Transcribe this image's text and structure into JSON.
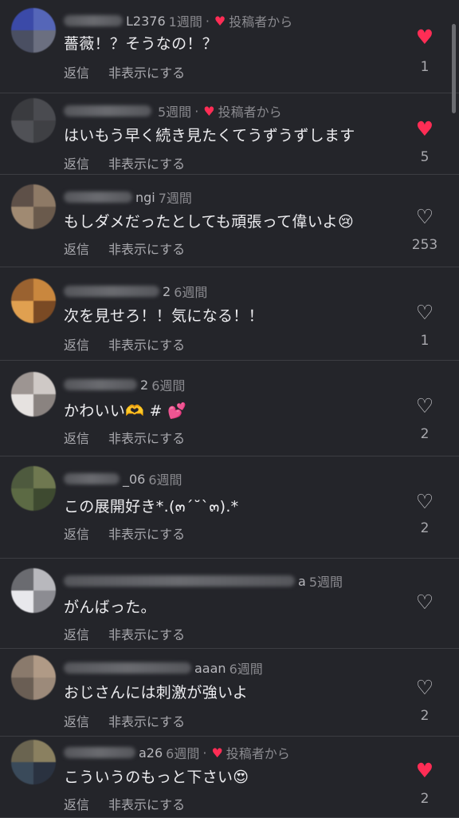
{
  "comments": [
    {
      "name_tail": "L2376",
      "time": "1週間",
      "liked_by_author": true,
      "author_label": "投稿者から",
      "text": "薔薇！？そうなの！？",
      "reply": "返信",
      "hide": "非表示にする",
      "liked": true,
      "likes": "1"
    },
    {
      "name_tail": "",
      "time": "5週間",
      "liked_by_author": true,
      "author_label": "投稿者から",
      "text": "はいもう早く続き見たくてうずうずします",
      "reply": "返信",
      "hide": "非表示にする",
      "liked": true,
      "likes": "5"
    },
    {
      "name_tail": "ngi",
      "time": "7週間",
      "liked_by_author": false,
      "author_label": "",
      "text": "もしダメだったとしても頑張って偉いよ😢",
      "reply": "返信",
      "hide": "非表示にする",
      "liked": false,
      "likes": "253"
    },
    {
      "name_tail": "2",
      "time": "6週間",
      "liked_by_author": false,
      "author_label": "",
      "text": "次を見せろ！！気になる！！",
      "reply": "返信",
      "hide": "非表示にする",
      "liked": false,
      "likes": "1"
    },
    {
      "name_tail": "2",
      "time": "6週間",
      "liked_by_author": false,
      "author_label": "",
      "text": "かわいい🫶 # 💕",
      "reply": "返信",
      "hide": "非表示にする",
      "liked": false,
      "likes": "2"
    },
    {
      "name_tail": "_06",
      "time": "6週間",
      "liked_by_author": false,
      "author_label": "",
      "text": "この展開好き*.(๓´˘`๓).*",
      "reply": "返信",
      "hide": "非表示にする",
      "liked": false,
      "likes": "2"
    },
    {
      "name_tail": "a",
      "time": "5週間",
      "liked_by_author": false,
      "author_label": "",
      "text": "がんばった。",
      "reply": "返信",
      "hide": "非表示にする",
      "liked": false,
      "likes": ""
    },
    {
      "name_tail": "aaan",
      "time": "6週間",
      "liked_by_author": false,
      "author_label": "",
      "text": "おじさんには刺激が強いよ",
      "reply": "返信",
      "hide": "非表示にする",
      "liked": false,
      "likes": "2"
    },
    {
      "name_tail": "a26",
      "time": "6週間",
      "liked_by_author": true,
      "author_label": "投稿者から",
      "text": "こういうのもっと下さい😍",
      "reply": "返信",
      "hide": "非表示にする",
      "liked": true,
      "likes": "2"
    }
  ],
  "icons": {
    "heart_filled": "heart-filled-icon",
    "heart_outline": "heart-outline-icon"
  },
  "colors": {
    "background": "#24252a",
    "like_red": "#ff2d55"
  }
}
